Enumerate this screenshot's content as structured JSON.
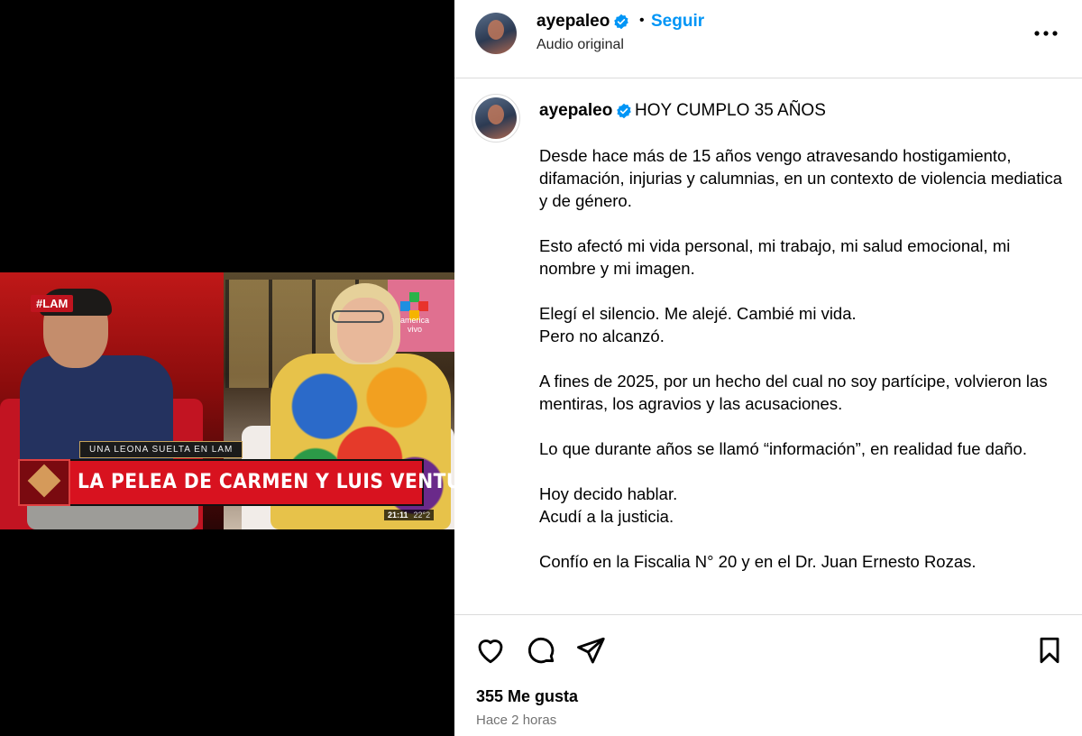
{
  "video": {
    "tag": "#LAM",
    "channel_logo_text": "america vivo",
    "lower_third_small": "UNA LEONA SUELTA EN LAM",
    "lower_third_title": "LA PELEA DE CARMEN Y LUIS VENTURA",
    "clock_time": "21:11",
    "clock_temp": "22°2",
    "logo_colors": [
      "#2ab24a",
      "#1f8fe0",
      "#e8332c",
      "#f5b400"
    ]
  },
  "header": {
    "username": "ayepaleo",
    "verified": true,
    "separator": "•",
    "follow_label": "Seguir",
    "audio_label": "Audio original"
  },
  "caption": {
    "username": "ayepaleo",
    "title": "HOY CUMPLO 35 AÑOS",
    "paragraphs": [
      "Desde hace más de 15 años vengo atravesando hostigamiento, difamación, injurias y calumnias, en un contexto de violencia mediatica y de género.",
      "Esto afectó mi vida personal, mi trabajo, mi salud emocional, mi nombre y mi imagen.",
      "Elegí el silencio. Me alejé. Cambié mi vida.\nPero no alcanzó.",
      "A fines de 2025, por un hecho del cual no soy partícipe, volvieron las mentiras, los agravios y las acusaciones.",
      "Lo que durante años se llamó “información”, en realidad fue daño.",
      "Hoy decido hablar.\nAcudí a la justicia.",
      "Confío en la Fiscalia N° 20 y en el Dr. Juan Ernesto Rozas."
    ]
  },
  "actions": {
    "icons": [
      "heart-icon",
      "comment-icon",
      "share-icon",
      "bookmark-icon"
    ]
  },
  "stats": {
    "likes": "355 Me gusta",
    "time_ago": "Hace 2 horas"
  },
  "colors": {
    "link_blue": "#0095f6",
    "verified_blue": "#0095f6",
    "divider": "#dbdbdb",
    "muted": "#737373"
  }
}
